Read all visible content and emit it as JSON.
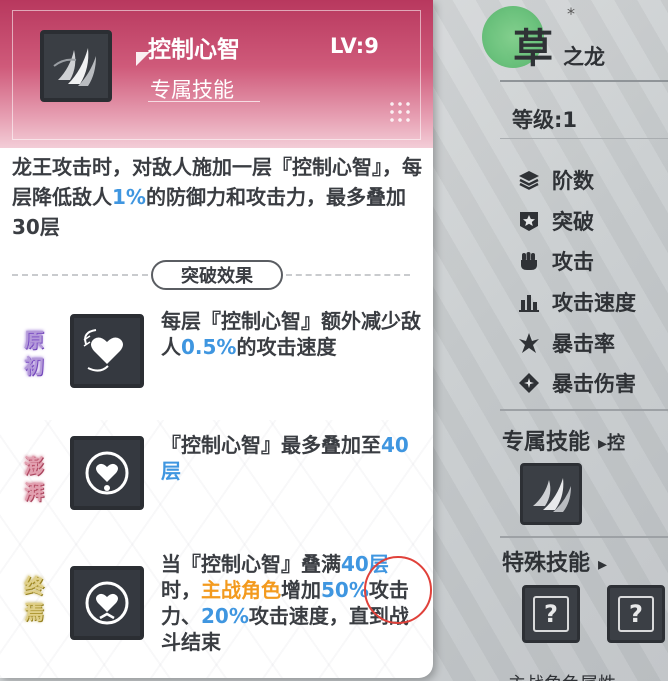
{
  "card": {
    "skill_name": "控制心智",
    "skill_level": "LV:9",
    "skill_type": "专属技能",
    "description": [
      {
        "text": "龙王攻击时，对敌人施加一层『控制心智』，每层降低敌人"
      },
      {
        "text": "1%",
        "hl": "blue"
      },
      {
        "text": "的防御力和攻击力，最多叠加30层"
      }
    ],
    "breakthrough_title": "突破效果",
    "breakthroughs": [
      {
        "tier": [
          "原",
          "初"
        ],
        "segments": [
          {
            "text": "每层『控制心智』额外减少敌人"
          },
          {
            "text": "0.5%",
            "hl": "blue"
          },
          {
            "text": "的攻击速度"
          }
        ]
      },
      {
        "tier": [
          "澎",
          "湃"
        ],
        "segments": [
          {
            "text": "『控制心智』最多叠加至"
          },
          {
            "text": "40层",
            "hl": "blue"
          }
        ]
      },
      {
        "tier": [
          "终",
          "焉"
        ],
        "segments": [
          {
            "text": "当『控制心智』叠满"
          },
          {
            "text": "40层",
            "hl": "blue"
          },
          {
            "text": "时，"
          },
          {
            "text": "主战角色",
            "hl": "orange"
          },
          {
            "text": "增加"
          },
          {
            "text": "50%",
            "hl": "blue"
          },
          {
            "text": "攻击力、"
          },
          {
            "text": "20%",
            "hl": "blue"
          },
          {
            "text": "攻击速度，直到战斗结束"
          }
        ]
      }
    ]
  },
  "right_panel": {
    "element": "草",
    "element_suffix": "之龙",
    "level": "等级:1",
    "stats": [
      {
        "icon": "layers-icon",
        "label": "阶数"
      },
      {
        "icon": "breakthrough-star-icon",
        "label": "突破"
      },
      {
        "icon": "fist-icon",
        "label": "攻击"
      },
      {
        "icon": "bar-chart-icon",
        "label": "攻击速度"
      },
      {
        "icon": "crit-rate-icon",
        "label": "暴击率"
      },
      {
        "icon": "crit-damage-icon",
        "label": "暴击伤害"
      }
    ],
    "exclusive_skill_label": "专属技能",
    "exclusive_skill_link": "▸控",
    "special_skill_label": "特殊技能",
    "special_skill_arrow": "▸",
    "unknown_slot_label": "?",
    "bottom_text": "主战角色属性"
  },
  "colors": {
    "header_red": "#b8385e",
    "highlight_blue": "#3f96e0",
    "highlight_orange": "#f39a1e",
    "annotation_red": "#e0413a"
  }
}
